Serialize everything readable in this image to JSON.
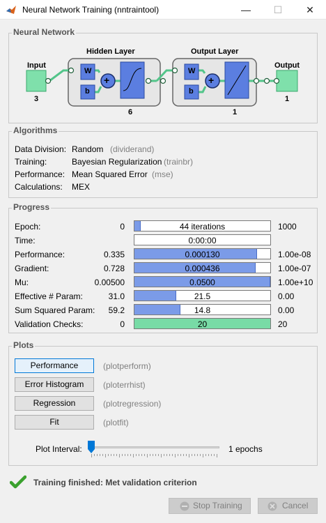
{
  "window": {
    "title": "Neural Network Training (nntraintool)",
    "min_glyph": "—",
    "max_glyph": "☐",
    "close_glyph": "✕"
  },
  "network": {
    "section_title": "Neural Network",
    "input_label": "Input",
    "input_size": "3",
    "hidden_label": "Hidden Layer",
    "hidden_size": "6",
    "output_layer_label": "Output Layer",
    "output_layer_size": "1",
    "output_label": "Output",
    "output_size": "1",
    "w_label": "W",
    "b_label": "b",
    "plus": "+"
  },
  "algorithms": {
    "section_title": "Algorithms",
    "rows": [
      {
        "label": "Data Division:",
        "value": "Random",
        "fn": "(dividerand)"
      },
      {
        "label": "Training:",
        "value": "Bayesian Regularization",
        "fn": "(trainbr)"
      },
      {
        "label": "Performance:",
        "value": "Mean Squared Error",
        "fn": "(mse)"
      },
      {
        "label": "Calculations:",
        "value": "MEX",
        "fn": ""
      }
    ]
  },
  "progress": {
    "section_title": "Progress",
    "rows": [
      {
        "label": "Epoch:",
        "min": "0",
        "current": "44 iterations",
        "max": "1000",
        "fill": 0.044
      },
      {
        "label": "Time:",
        "min": "",
        "current": "0:00:00",
        "max": "",
        "fill": 0
      },
      {
        "label": "Performance:",
        "min": "0.335",
        "current": "0.000130",
        "max": "1.00e-08",
        "fill": 0.9
      },
      {
        "label": "Gradient:",
        "min": "0.728",
        "current": "0.000436",
        "max": "1.00e-07",
        "fill": 0.89
      },
      {
        "label": "Mu:",
        "min": "0.00500",
        "current": "0.0500",
        "max": "1.00e+10",
        "fill": 1.0
      },
      {
        "label": "Effective # Param:",
        "min": "31.0",
        "current": "21.5",
        "max": "0.00",
        "fill": 0.31
      },
      {
        "label": "Sum Squared Param:",
        "min": "59.2",
        "current": "14.8",
        "max": "0.00",
        "fill": 0.34
      },
      {
        "label": "Validation Checks:",
        "min": "0",
        "current": "20",
        "max": "20",
        "fill": 1.0
      }
    ]
  },
  "plots": {
    "section_title": "Plots",
    "buttons": [
      {
        "label": "Performance",
        "cmd": "(plotperform)"
      },
      {
        "label": "Error Histogram",
        "cmd": "(ploterrhist)"
      },
      {
        "label": "Regression",
        "cmd": "(plotregression)"
      },
      {
        "label": "Fit",
        "cmd": "(plotfit)"
      }
    ],
    "interval_label": "Plot Interval:",
    "interval_value": "1 epochs",
    "interval_fraction": 0.0
  },
  "status": {
    "message": "Training finished: Met validation criterion"
  },
  "footer": {
    "stop_label": "Stop Training",
    "cancel_label": "Cancel"
  },
  "colors": {
    "progress_fill": "#7b9be8",
    "validation_fill": "#78dba6",
    "accent": "#0078d7",
    "status_check": "#3aa12e"
  }
}
